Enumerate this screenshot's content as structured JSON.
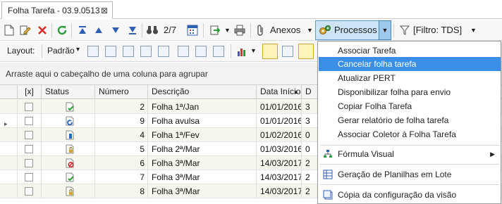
{
  "tab": {
    "title": "Folha Tarefa - 03.9.0513",
    "close": "⊠"
  },
  "toolbar1": {
    "record_position": "2/7",
    "attachments_label": "Anexos",
    "processes_label": "Processos",
    "filter_label": "[Filtro: TDS]",
    "dropdown_glyph": "▼"
  },
  "toolbar2": {
    "layout_label": "Layout:",
    "layout_value": "Padrão",
    "dropdown_glyph": "▾"
  },
  "group_panel": {
    "text": "Arraste aqui o cabeçalho de uma coluna para agrupar"
  },
  "grid": {
    "columns": [
      "[x]",
      "Status",
      "Número",
      "Descrição",
      "Data Início",
      "D"
    ],
    "sort_indicator": "▲",
    "current_row_marker": "▸",
    "rows": [
      {
        "number": "2",
        "description": "Folha 1ª/Jan",
        "start_date": "01/01/2016",
        "extra": "3",
        "status_icon": "doc-check-icon"
      },
      {
        "number": "9",
        "description": "Folha avulsa",
        "start_date": "01/01/2016",
        "extra": "3",
        "status_icon": "doc-refresh-icon"
      },
      {
        "number": "4",
        "description": "Folha 1ª/Fev",
        "start_date": "01/02/2016",
        "extra": "0",
        "status_icon": "doc-device-icon"
      },
      {
        "number": "5",
        "description": "Folha 2ª/Mar",
        "start_date": "01/03/2016",
        "extra": "0",
        "status_icon": "doc-lock-icon"
      },
      {
        "number": "6",
        "description": "Folha 3ª/Mar",
        "start_date": "14/03/2017",
        "extra": "2",
        "status_icon": "doc-cancel-icon"
      },
      {
        "number": "7",
        "description": "Folha 3ª/Mar",
        "start_date": "14/03/2017",
        "extra": "2",
        "status_icon": "doc-check-icon"
      },
      {
        "number": "8",
        "description": "Folha 3ª/Mar",
        "start_date": "14/03/2017",
        "extra": "2",
        "status_icon": "doc-lock-icon"
      }
    ]
  },
  "menu": {
    "items": [
      "Associar Tarefa",
      "Cancelar folha tarefa",
      "Atualizar PERT",
      "Disponibilizar folha para envio",
      "Copiar Folha Tarefa",
      "Gerar relatório de folha tarefa",
      "Associar Coletor à Folha Tarefa",
      "Fórmula Visual",
      "Geração de Planilhas em Lote",
      "Cópia da configuração da visão"
    ],
    "submenu_arrow": "▶"
  },
  "colors": {
    "menu_highlight": "#3a8ee6",
    "active_button": "#cde4f7",
    "row_alt": "#f6f6ec"
  }
}
